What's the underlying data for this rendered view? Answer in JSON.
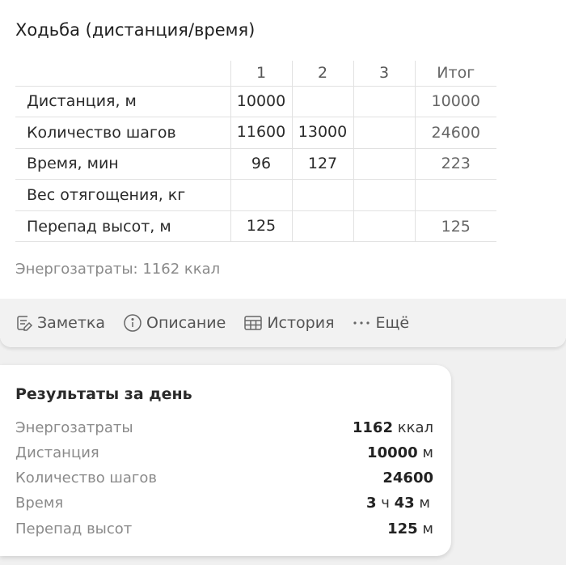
{
  "workout": {
    "title": "Ходьба (дистанция/время)",
    "headers": [
      "1",
      "2",
      "3",
      "Итог"
    ],
    "rows": [
      {
        "label": "Дистанция, м",
        "v1": "10000",
        "v2": "",
        "v3": "",
        "total": "10000"
      },
      {
        "label": "Количество шагов",
        "v1": "11600",
        "v2": "13000",
        "v3": "",
        "total": "24600"
      },
      {
        "label": "Время, мин",
        "v1": "96",
        "v2": "127",
        "v3": "",
        "total": "223"
      },
      {
        "label": "Вес отягощения, кг",
        "v1": "",
        "v2": "",
        "v3": "",
        "total": ""
      },
      {
        "label": "Перепад высот, м",
        "v1": "125",
        "v2": "",
        "v3": "",
        "total": "125"
      }
    ],
    "energy_text": "Энергозатраты: 1162 ккал"
  },
  "toolbar": {
    "note_label": "Заметка",
    "description_label": "Описание",
    "history_label": "История",
    "more_label": "Ещё",
    "icons": [
      "note-icon",
      "info-icon",
      "table-icon",
      "more-icon"
    ]
  },
  "results": {
    "title": "Результаты за день",
    "items": [
      {
        "label": "Энергозатраты",
        "value": "1162",
        "unit": "ккал"
      },
      {
        "label": "Дистанция",
        "value": "10000",
        "unit": "м"
      },
      {
        "label": "Количество шагов",
        "value": "24600",
        "unit": ""
      },
      {
        "label": "Время",
        "value_h": "3",
        "unit_h": "ч",
        "value_m": "43",
        "unit_m": "м"
      },
      {
        "label": "Перепад высот",
        "value": "125",
        "unit": "м"
      }
    ]
  }
}
